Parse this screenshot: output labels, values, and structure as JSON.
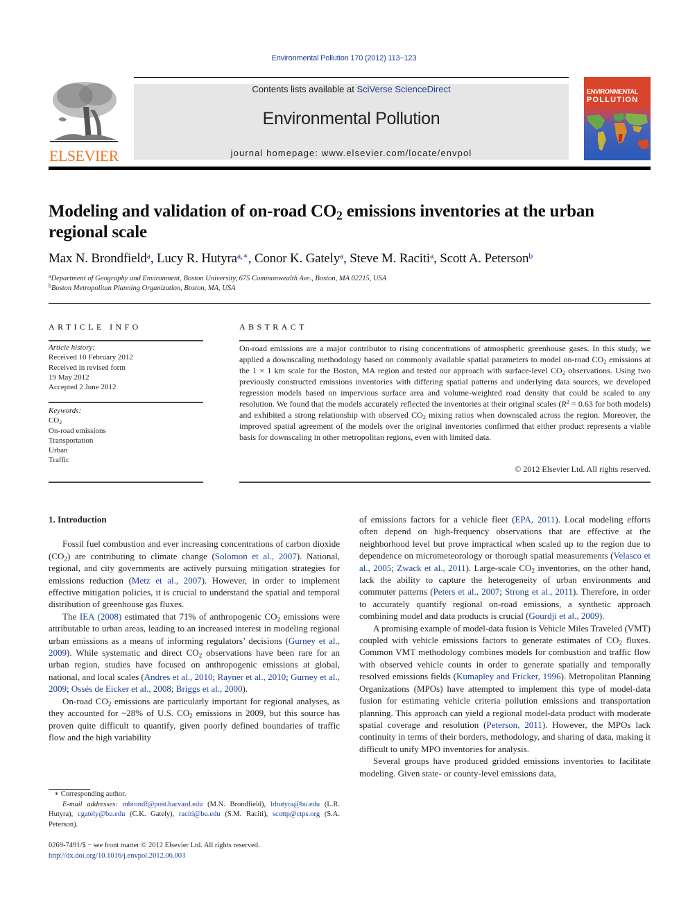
{
  "journal_ref": "Environmental Pollution 170 (2012) 113−123",
  "masthead": {
    "contents_prefix": "Contents lists available at ",
    "contents_link": "SciVerse ScienceDirect",
    "journal_title": "Environmental Pollution",
    "homepage": "journal homepage: www.elsevier.com/locate/envpol",
    "publisher_logo_text": "ELSEVIER",
    "cover_title_1": "ENVIRONMENTAL",
    "cover_title_2": "POLLUTION"
  },
  "colors": {
    "link": "#1b3f94",
    "elsevier_orange": "#e87722",
    "masthead_bg": "#e6e6e6"
  },
  "article": {
    "title_pre": "Modeling and validation of on-road CO",
    "title_sub": "2",
    "title_post": " emissions inventories at the urban regional scale",
    "authors": [
      {
        "name": "Max N. Brondfield",
        "sup": "a",
        "sep": ", "
      },
      {
        "name": "Lucy R. Hutyra",
        "sup": "a,∗",
        "sep": ", "
      },
      {
        "name": "Conor K. Gately",
        "sup": "a",
        "sep": ", "
      },
      {
        "name": "Steve M. Raciti",
        "sup": "a",
        "sep": ", "
      },
      {
        "name": "Scott A. Peterson",
        "sup": "b",
        "sep": ""
      }
    ],
    "affiliations": [
      {
        "key": "a",
        "text": "Department of Geography and Environment, Boston University, 675 Commonwealth Ave., Boston, MA 02215, USA"
      },
      {
        "key": "b",
        "text": "Boston Metropolitan Planning Organization, Boston, MA, USA"
      }
    ]
  },
  "article_info": {
    "heading": "ARTICLE INFO",
    "history_label": "Article history:",
    "history": [
      "Received 10 February 2012",
      "Received in revised form",
      "19 May 2012",
      "Accepted 2 June 2012"
    ],
    "keywords_label": "Keywords:",
    "keywords": [
      "CO2",
      "On-road emissions",
      "Transportation",
      "Urban",
      "Traffic"
    ]
  },
  "abstract": {
    "heading": "ABSTRACT",
    "p1": "On-road emissions are a major contributor to rising concentrations of atmospheric greenhouse gases. In this study, we applied a downscaling methodology based on commonly available spatial parameters to model on-road CO",
    "p2": " emissions at the 1 × 1 km scale for the Boston, MA region and tested our approach with surface-level CO",
    "p3": " observations. Using two previously constructed emissions inventories with differing spatial patterns and underlying data sources, we developed regression models based on impervious surface area and volume-weighted road density that could be scaled to any resolution. We found that the models accurately reflected the inventories at their original scales (",
    "r2_var": "R",
    "r2_exp": "2",
    "p4": " = 0.63 for both models) and exhibited a strong relationship with observed CO",
    "p5": " mixing ratios when downscaled across the region. Moreover, the improved spatial agreement of the models over the original inventories confirmed that either product represents a viable basis for downscaling in other metropolitan regions, even with limited data.",
    "copyright": "© 2012 Elsevier Ltd. All rights reserved."
  },
  "intro": {
    "heading": "1.  Introduction",
    "left": {
      "p1": [
        "Fossil fuel combustion and ever increasing concentrations of carbon dioxide (CO",
        ") are contributing to climate change (",
        "Solomon et al., 2007",
        "). National, regional, and city governments are actively pursuing mitigation strategies for emissions reduction (",
        "Metz et al., 2007",
        "). However, in order to implement effective mitigation policies, it is crucial to understand the spatial and temporal distribution of greenhouse gas fluxes."
      ],
      "p2": [
        "The ",
        "IEA (2008)",
        " estimated that 71% of anthropogenic CO",
        " emissions were attributable to urban areas, leading to an increased interest in modeling regional urban emissions as a means of informing regulators’ decisions (",
        "Gurney et al., 2009",
        "). While systematic and direct CO",
        " observations have been rare for an urban region, studies have focused on anthropogenic emissions at global, national, and local scales (",
        "Andres et al., 2010",
        "; ",
        "Rayner et al., 2010",
        "; ",
        "Gurney et al., 2009",
        "; ",
        "Ossés de Eicker et al., 2008",
        "; ",
        "Briggs et al., 2000",
        ")."
      ],
      "p3": [
        "On-road CO",
        " emissions are particularly important for regional analyses, as they accounted for ~28% of U.S. CO",
        " emissions in 2009, but this source has proven quite difficult to quantify, given poorly defined boundaries of traffic flow and the high variability"
      ]
    },
    "right": {
      "p1": [
        "of emissions factors for a vehicle fleet (",
        "EPA, 2011",
        "). Local modeling efforts often depend on high-frequency observations that are effective at the neighborhood level but prove impractical when scaled up to the region due to dependence on micrometeorology or thorough spatial measurements (",
        "Velasco et al., 2005",
        "; ",
        "Zwack et al., 2011",
        "). Large-scale CO",
        " inventories, on the other hand, lack the ability to capture the heterogeneity of urban environments and commuter patterns (",
        "Peters et al., 2007",
        "; ",
        "Strong et al., 2011",
        "). Therefore, in order to accurately quantify regional on-road emissions, a synthetic approach combining model and data products is crucial (",
        "Gourdji et al., 2009",
        ")."
      ],
      "p2": [
        "A promising example of model-data fusion is Vehicle Miles Traveled (VMT) coupled with vehicle emissions factors to generate estimates of CO",
        " fluxes. Common VMT methodology combines models for combustion and traffic flow with observed vehicle counts in order to generate spatially and temporally resolved emissions fields (",
        "Kumapley and Fricker, 1996",
        "). Metropolitan Planning Organizations (MPOs) have attempted to implement this type of model-data fusion for estimating vehicle criteria pollution emissions and transportation planning. This approach can yield a regional model-data product with moderate spatial coverage and resolution (",
        "Peterson, 2011",
        "). However, the MPOs lack continuity in terms of their borders, methodology, and sharing of data, making it difficult to unify MPO inventories for analysis."
      ],
      "p3": "Several groups have produced gridded emissions inventories to facilitate modeling. Given state- or county-level emissions data,"
    }
  },
  "footnotes": {
    "corresponding": "∗ Corresponding author.",
    "email_label": "E-mail addresses:",
    "emails": [
      {
        "addr": "mbrondf@post.harvard.edu",
        "who": " (M.N. Brondfield), "
      },
      {
        "addr": "lrhutyra@bu.edu",
        "who": " (L.R. Hutyra), "
      },
      {
        "addr": "cgately@bu.edu",
        "who": " (C.K. Gately), "
      },
      {
        "addr": "raciti@bu.edu",
        "who": " (S.M. Raciti), "
      },
      {
        "addr": "scottp@ctps.org",
        "who": " (S.A. Peterson)."
      }
    ],
    "front_matter": "0269-7491/$ − see front matter © 2012 Elsevier Ltd. All rights reserved.",
    "doi": "http://dx.doi.org/10.1016/j.envpol.2012.06.003"
  },
  "subscript_2": "2"
}
